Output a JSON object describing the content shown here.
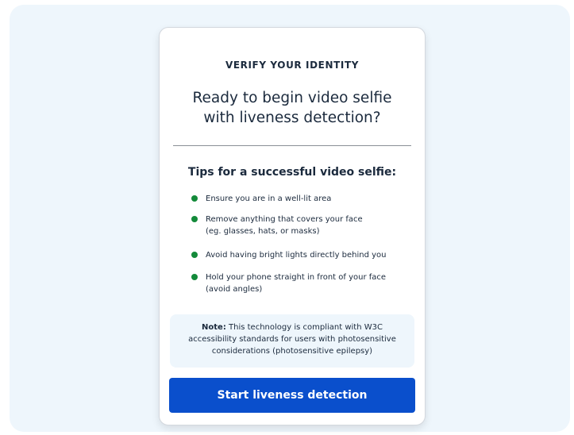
{
  "card": {
    "eyebrow": "VERIFY YOUR IDENTITY",
    "title_line1": "Ready to begin video selfie",
    "title_line2": "with liveness detection?",
    "tips_heading": "Tips for a successful video selfie:",
    "tips": [
      {
        "line1": "Ensure you are in a well-lit area",
        "line2": ""
      },
      {
        "line1": "Remove anything that covers your face",
        "line2": "(eg. glasses, hats, or masks)"
      },
      {
        "line1": "Avoid having bright lights directly behind you",
        "line2": ""
      },
      {
        "line1": "Hold your phone straight in front of your face",
        "line2": "(avoid angles)"
      }
    ],
    "note": {
      "label": "Note:",
      "line1": "This technology is compliant with W3C",
      "line2": "accessibility standards for users with photosensitive",
      "line3": "considerations (photosensitive epilepsy)"
    },
    "cta_label": "Start liveness detection"
  },
  "colors": {
    "background": "#eef6fc",
    "text": "#1b2a3d",
    "bullet": "#138a3a",
    "button": "#0a4fcc"
  }
}
